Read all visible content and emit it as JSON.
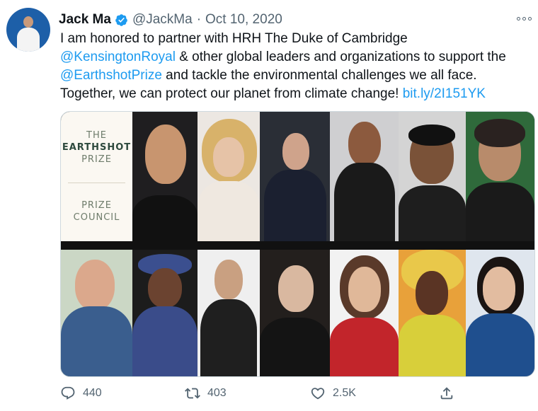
{
  "tweet": {
    "author_name": "Jack Ma",
    "handle": "@JackMa",
    "separator": "·",
    "date": "Oct 10, 2020",
    "text_part1": "I am honored to partner with HRH The Duke of Cambridge",
    "mention_kensington": "@KensingtonRoyal",
    "text_part2": " & other global leaders and organizations to support the",
    "mention_earthshot": "@EarthshotPrize",
    "text_part3": " and tackle the environmental challenges we all face.",
    "text_part4": "Together, we can protect our planet from climate change! ",
    "link": "bit.ly/2I151YK"
  },
  "media": {
    "earthshot_line1": "THE",
    "earthshot_line2": "EARTHSHOT",
    "earthshot_line3": "PRIZE",
    "council_line1": "PRIZE",
    "council_line2": "COUNCIL"
  },
  "actions": {
    "replies": "440",
    "retweets": "403",
    "likes": "2.5K"
  },
  "colors": {
    "link": "#1d9bf0",
    "verified": "#1d9bf0",
    "muted": "#536471"
  },
  "icons": [
    "verified-badge-icon",
    "more-icon",
    "reply-icon",
    "retweet-icon",
    "like-icon",
    "share-icon"
  ]
}
